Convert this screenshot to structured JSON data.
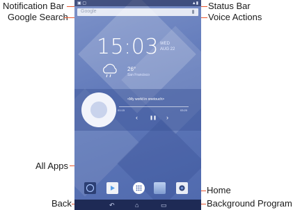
{
  "callouts": {
    "notification_bar": "Notification Bar",
    "google_search": "Google Search",
    "status_bar": "Status Bar",
    "voice_actions": "Voice Actions",
    "all_apps": "All Apps",
    "home": "Home",
    "back": "Back",
    "background_program": "Background Program"
  },
  "accent_color": "#e8542c",
  "phone": {
    "search_placeholder": "Google",
    "clock": {
      "time": "15:03",
      "day": "WED",
      "date": "AUG 22"
    },
    "weather": {
      "temp": "26°",
      "city": "San Francisco",
      "icon": "cloud-rain-icon"
    },
    "music": {
      "title": "<My world in onetouch>",
      "elapsed": "01:15",
      "total": "03:20",
      "prev": "‹",
      "pause": "❚❚",
      "next": "›"
    },
    "dock_icons": [
      "browser-icon",
      "play-store-icon",
      "all-apps-icon",
      "gallery-icon",
      "camera-icon"
    ],
    "nav": {
      "back": "↶",
      "home": "⌂",
      "recent": "▭"
    }
  }
}
